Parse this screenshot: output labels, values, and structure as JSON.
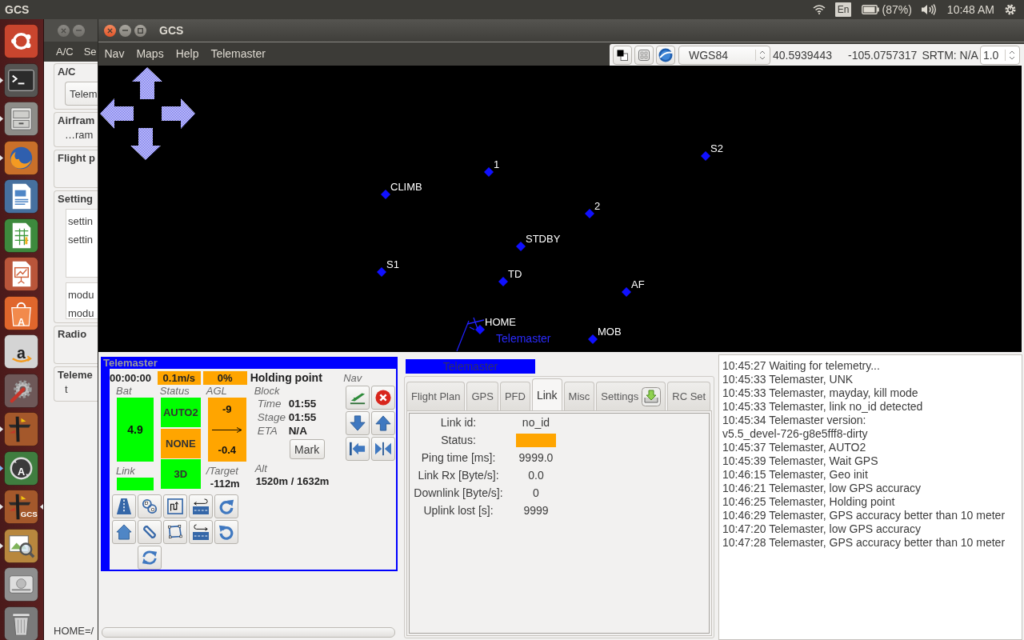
{
  "top_bar": {
    "title": "GCS",
    "keyboard_layout": "En",
    "battery": "(87%)",
    "clock": "10:48 AM"
  },
  "launcher": {
    "items": [
      {
        "kind": "home",
        "running": false,
        "active": false
      },
      {
        "kind": "terminal",
        "running": true,
        "active": false
      },
      {
        "kind": "files",
        "running": true,
        "active": false
      },
      {
        "kind": "browser",
        "running": true,
        "active": false
      },
      {
        "kind": "writer",
        "running": false,
        "active": false
      },
      {
        "kind": "calc",
        "running": false,
        "active": false
      },
      {
        "kind": "impress",
        "running": false,
        "active": false
      },
      {
        "kind": "store",
        "running": false,
        "active": false,
        "glyph": "A"
      },
      {
        "kind": "shop",
        "running": false,
        "active": false,
        "glyph": "a"
      },
      {
        "kind": "settings",
        "running": false,
        "active": false
      },
      {
        "kind": "aircraft",
        "running": true,
        "active": false
      },
      {
        "kind": "updater",
        "running": true,
        "active": false,
        "glyph": "A"
      },
      {
        "kind": "aircraft",
        "running": true,
        "active": true,
        "glyph": "GCS"
      },
      {
        "kind": "viewer",
        "running": true,
        "active": false
      },
      {
        "kind": "drive",
        "running": false,
        "active": false
      },
      {
        "kind": "trash",
        "running": false,
        "active": false
      }
    ]
  },
  "back_window": {
    "menu": [
      "A/C",
      "Se"
    ],
    "groups": [
      {
        "kind": "combo",
        "title": "A/C",
        "combo": "Telem"
      },
      {
        "kind": "rows",
        "title": "Airfram",
        "rows": [
          "…ram"
        ]
      },
      {
        "kind": "empty",
        "title": "Flight p"
      },
      {
        "kind": "lists",
        "title": "Setting",
        "lists": [
          [
            "settin",
            "settin"
          ],
          [
            "modu",
            "modu"
          ]
        ]
      },
      {
        "kind": "empty",
        "title": "Radio"
      },
      {
        "kind": "rows",
        "title": "Teleme",
        "rows": [
          "t"
        ]
      }
    ],
    "status": "HOME=/"
  },
  "gcs_window": {
    "title": "GCS",
    "menu": [
      "Nav",
      "Maps",
      "Help",
      "Telemaster"
    ],
    "toolbar": {
      "projection": "WGS84",
      "latitude": "40.5939443",
      "longitude": "-105.0757317",
      "elevation": "SRTM: N/A",
      "zoom": "1.0"
    },
    "map": {
      "waypoints": [
        {
          "name": "S2"
        },
        {
          "name": "1"
        },
        {
          "name": "CLIMB"
        },
        {
          "name": "2"
        },
        {
          "name": "STDBY"
        },
        {
          "name": "S1"
        },
        {
          "name": "TD"
        },
        {
          "name": "AF"
        },
        {
          "name": "HOME"
        },
        {
          "name": "MOB"
        }
      ],
      "aircraft": "Telemaster"
    },
    "strip": {
      "title": "Telemaster",
      "flight_time": "00:00:00",
      "speed": {
        "value": "0.1m/s",
        "color": "#ffa500"
      },
      "throttle": {
        "value": "0%",
        "color": "#ffa500"
      },
      "block_name": "Holding point",
      "nav_label": "Nav",
      "bat": {
        "label": "Bat",
        "value": "4.9",
        "color": "#00ff00"
      },
      "status": {
        "label": "Status",
        "cells": [
          {
            "value": "AUTO2",
            "color": "#00ff00"
          },
          {
            "value": "NONE",
            "color": "#ffa500"
          },
          {
            "value": "3D",
            "color": "#00ff00"
          }
        ]
      },
      "agl": {
        "label": "AGL",
        "value": "-9",
        "climb": "-0.4",
        "color": "#ffa500"
      },
      "block": {
        "label": "Block",
        "rows": [
          {
            "label": "Time",
            "value": "01:55"
          },
          {
            "label": "Stage",
            "value": "01:55"
          },
          {
            "label": "ETA",
            "value": "N/A"
          }
        ]
      },
      "mark_button": "Mark",
      "link": {
        "label": "Link",
        "color": "#00ff00"
      },
      "target": {
        "label": "/Target",
        "value": "-112m"
      },
      "alt": {
        "label": "Alt",
        "value": "1520m / 1632m"
      }
    },
    "notebook": {
      "title": "Telemaster",
      "tabs": [
        {
          "label": "Flight Plan",
          "kind": "plain",
          "selected": false
        },
        {
          "label": "GPS",
          "kind": "plain",
          "selected": false
        },
        {
          "label": "PFD",
          "kind": "plain",
          "selected": false
        },
        {
          "label": "Link",
          "kind": "plain",
          "selected": true
        },
        {
          "label": "Misc",
          "kind": "plain",
          "selected": false
        },
        {
          "label": "Settings",
          "kind": "with_button",
          "selected": false
        },
        {
          "label": "RC Set",
          "kind": "plain",
          "selected": false
        }
      ],
      "link_rows": [
        {
          "label": "Link id:",
          "kind": "text",
          "value": "no_id"
        },
        {
          "label": "Status:",
          "kind": "swatch",
          "color": "#ffa500"
        },
        {
          "label": "Ping time [ms]:",
          "kind": "text",
          "value": "9999.0"
        },
        {
          "label": "Link Rx [Byte/s]:",
          "kind": "text",
          "value": "0.0"
        },
        {
          "label": "Downlink [Byte/s]:",
          "kind": "text",
          "value": "0"
        },
        {
          "label": "Uplink lost [s]:",
          "kind": "text",
          "value": "9999"
        }
      ]
    },
    "log": [
      "10:45:27 Waiting for telemetry...",
      "10:45:33 Telemaster, UNK",
      "10:45:33 Telemaster, mayday, kill mode",
      "10:45:33 Telemaster, link no_id detected",
      "10:45:34 Telemaster version:",
      "v5.5_devel-726-g8e5fff8-dirty",
      "10:45:37 Telemaster, AUTO2",
      "10:45:39 Telemaster, Wait GPS",
      "10:46:15 Telemaster, Geo init",
      "10:46:21 Telemaster, low GPS accuracy",
      "10:46:25 Telemaster, Holding point",
      "10:46:29 Telemaster, GPS accuracy better than 10 meter",
      "10:47:20 Telemaster, low GPS accuracy",
      "10:47:28 Telemaster, GPS accuracy better than 10 meter"
    ]
  }
}
